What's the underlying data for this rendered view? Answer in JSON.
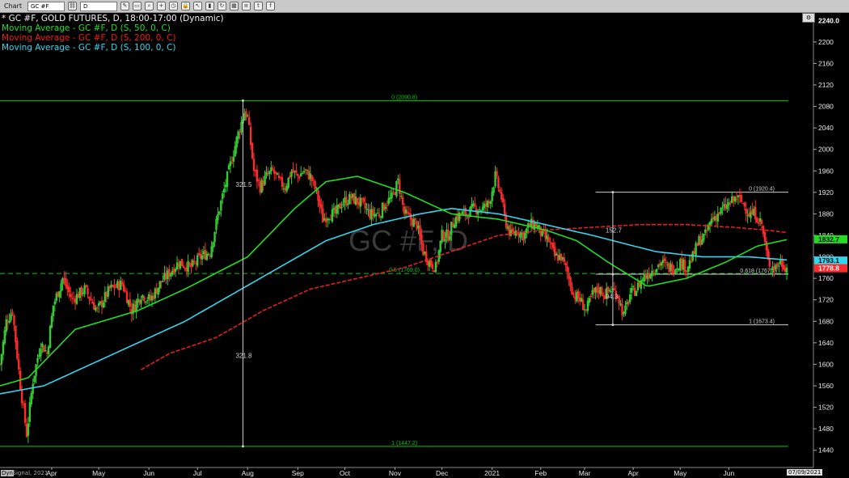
{
  "toolbar": {
    "chart_label": "Chart",
    "symbol_value": "GC #F",
    "interval_value": "D"
  },
  "legend": {
    "main": "* GC #F, GOLD FUTURES, D, 18:00-17:00 (Dynamic)",
    "ma50": "Moving Average - GC #F, D (S, 50, 0, C)",
    "ma200": "Moving Average - GC #F, D (S, 200, 0, C)",
    "ma100": "Moving Average - GC #F, D (S, 100, 0, C)"
  },
  "colors": {
    "background": "#000000",
    "up_candle": "#33cc33",
    "down_candle": "#ff2b2b",
    "ma50": "#22dd22",
    "ma100": "#33d6ee",
    "ma200": "#ee1b1b",
    "fib": "#00cc00",
    "measure": "#cfcfcf"
  },
  "bottom": {
    "copyright": "© eSignal, 2021",
    "dyn_label": "Dyn",
    "last_date": "07/09/2021"
  },
  "chart_data": {
    "type": "candlestick",
    "watermark": "GC #F, D",
    "ylim": [
      1420,
      2250
    ],
    "yticks": [
      1440,
      1480,
      1520,
      1560,
      1600,
      1640,
      1680,
      1720,
      1760,
      1800,
      1840,
      1880,
      1920,
      1960,
      2000,
      2040,
      2080,
      2120,
      2160,
      2200,
      2240
    ],
    "xticks": [
      {
        "label": "Apr",
        "day": 15
      },
      {
        "label": "May",
        "day": 45
      },
      {
        "label": "Jun",
        "day": 77
      },
      {
        "label": "Jul",
        "day": 108
      },
      {
        "label": "Aug",
        "day": 140
      },
      {
        "label": "Sep",
        "day": 172
      },
      {
        "label": "Oct",
        "day": 202
      },
      {
        "label": "Nov",
        "day": 234
      },
      {
        "label": "Dec",
        "day": 264
      },
      {
        "label": "2021",
        "day": 296
      },
      {
        "label": "Feb",
        "day": 327
      },
      {
        "label": "Mar",
        "day": 355
      },
      {
        "label": "Apr",
        "day": 386
      },
      {
        "label": "May",
        "day": 416
      },
      {
        "label": "Jun",
        "day": 447
      }
    ],
    "day_range": [
      -18,
      485
    ],
    "price_anchors": [
      [
        -18,
        1600
      ],
      [
        -14,
        1680
      ],
      [
        -10,
        1700
      ],
      [
        -5,
        1560
      ],
      [
        -1,
        1470
      ],
      [
        3,
        1570
      ],
      [
        8,
        1640
      ],
      [
        12,
        1620
      ],
      [
        16,
        1710
      ],
      [
        22,
        1760
      ],
      [
        28,
        1720
      ],
      [
        36,
        1740
      ],
      [
        44,
        1700
      ],
      [
        52,
        1740
      ],
      [
        60,
        1750
      ],
      [
        66,
        1700
      ],
      [
        72,
        1730
      ],
      [
        78,
        1720
      ],
      [
        84,
        1750
      ],
      [
        90,
        1770
      ],
      [
        96,
        1790
      ],
      [
        104,
        1780
      ],
      [
        110,
        1800
      ],
      [
        116,
        1810
      ],
      [
        122,
        1890
      ],
      [
        128,
        1960
      ],
      [
        134,
        2030
      ],
      [
        138,
        2070
      ],
      [
        140,
        2060
      ],
      [
        144,
        1960
      ],
      [
        148,
        1930
      ],
      [
        152,
        1950
      ],
      [
        156,
        1960
      ],
      [
        160,
        1940
      ],
      [
        164,
        1930
      ],
      [
        168,
        1960
      ],
      [
        172,
        1950
      ],
      [
        176,
        1960
      ],
      [
        180,
        1950
      ],
      [
        184,
        1920
      ],
      [
        188,
        1870
      ],
      [
        192,
        1880
      ],
      [
        196,
        1880
      ],
      [
        200,
        1900
      ],
      [
        206,
        1910
      ],
      [
        212,
        1900
      ],
      [
        218,
        1880
      ],
      [
        224,
        1880
      ],
      [
        228,
        1900
      ],
      [
        232,
        1910
      ],
      [
        236,
        1940
      ],
      [
        240,
        1880
      ],
      [
        244,
        1870
      ],
      [
        248,
        1860
      ],
      [
        252,
        1810
      ],
      [
        256,
        1790
      ],
      [
        260,
        1780
      ],
      [
        264,
        1840
      ],
      [
        268,
        1840
      ],
      [
        272,
        1870
      ],
      [
        276,
        1880
      ],
      [
        280,
        1880
      ],
      [
        284,
        1890
      ],
      [
        290,
        1890
      ],
      [
        294,
        1900
      ],
      [
        298,
        1950
      ],
      [
        302,
        1910
      ],
      [
        304,
        1870
      ],
      [
        308,
        1840
      ],
      [
        312,
        1850
      ],
      [
        316,
        1840
      ],
      [
        320,
        1860
      ],
      [
        324,
        1860
      ],
      [
        328,
        1840
      ],
      [
        332,
        1830
      ],
      [
        336,
        1800
      ],
      [
        340,
        1800
      ],
      [
        344,
        1770
      ],
      [
        348,
        1730
      ],
      [
        352,
        1720
      ],
      [
        356,
        1700
      ],
      [
        360,
        1730
      ],
      [
        364,
        1740
      ],
      [
        368,
        1730
      ],
      [
        372,
        1740
      ],
      [
        376,
        1730
      ],
      [
        380,
        1690
      ],
      [
        384,
        1730
      ],
      [
        388,
        1740
      ],
      [
        392,
        1760
      ],
      [
        396,
        1770
      ],
      [
        400,
        1780
      ],
      [
        404,
        1790
      ],
      [
        408,
        1780
      ],
      [
        412,
        1780
      ],
      [
        416,
        1790
      ],
      [
        420,
        1780
      ],
      [
        424,
        1800
      ],
      [
        428,
        1830
      ],
      [
        432,
        1840
      ],
      [
        436,
        1870
      ],
      [
        440,
        1880
      ],
      [
        444,
        1890
      ],
      [
        448,
        1900
      ],
      [
        452,
        1910
      ],
      [
        456,
        1900
      ],
      [
        460,
        1880
      ],
      [
        464,
        1880
      ],
      [
        468,
        1860
      ],
      [
        472,
        1790
      ],
      [
        476,
        1780
      ],
      [
        480,
        1790
      ],
      [
        484,
        1780
      ]
    ],
    "ma50": [
      [
        -18,
        1560
      ],
      [
        0,
        1575
      ],
      [
        30,
        1665
      ],
      [
        70,
        1700
      ],
      [
        100,
        1740
      ],
      [
        120,
        1770
      ],
      [
        140,
        1800
      ],
      [
        170,
        1890
      ],
      [
        190,
        1940
      ],
      [
        210,
        1950
      ],
      [
        240,
        1920
      ],
      [
        270,
        1880
      ],
      [
        300,
        1870
      ],
      [
        330,
        1850
      ],
      [
        350,
        1830
      ],
      [
        370,
        1790
      ],
      [
        395,
        1745
      ],
      [
        420,
        1760
      ],
      [
        445,
        1790
      ],
      [
        465,
        1820
      ],
      [
        485,
        1832.7
      ]
    ],
    "ma100": [
      [
        -18,
        1545
      ],
      [
        10,
        1560
      ],
      [
        40,
        1600
      ],
      [
        70,
        1640
      ],
      [
        100,
        1680
      ],
      [
        130,
        1730
      ],
      [
        160,
        1780
      ],
      [
        190,
        1830
      ],
      [
        220,
        1860
      ],
      [
        250,
        1880
      ],
      [
        270,
        1890
      ],
      [
        300,
        1880
      ],
      [
        330,
        1860
      ],
      [
        360,
        1840
      ],
      [
        380,
        1825
      ],
      [
        400,
        1810
      ],
      [
        430,
        1800
      ],
      [
        460,
        1800
      ],
      [
        485,
        1794
      ]
    ],
    "ma200": [
      [
        72,
        1590
      ],
      [
        90,
        1620
      ],
      [
        120,
        1650
      ],
      [
        150,
        1700
      ],
      [
        180,
        1740
      ],
      [
        210,
        1760
      ],
      [
        240,
        1780
      ],
      [
        270,
        1810
      ],
      [
        300,
        1840
      ],
      [
        330,
        1850
      ],
      [
        360,
        1855
      ],
      [
        390,
        1860
      ],
      [
        420,
        1860
      ],
      [
        450,
        1855
      ],
      [
        470,
        1850
      ],
      [
        485,
        1845
      ]
    ],
    "price_labels": [
      {
        "value": 2240.0,
        "label": "2240.0",
        "bg": "#000000",
        "fg": "#ffffff"
      },
      {
        "value": 1832.7,
        "label": "1832.7",
        "bg": "#22dd22",
        "fg": "#000000"
      },
      {
        "value": 1793.1,
        "label": "1793.1",
        "bg": "#33d6ee",
        "fg": "#000000"
      },
      {
        "value": 1778.8,
        "label": "1778.8",
        "bg": "#ff2b2b",
        "fg": "#ffffff"
      }
    ],
    "fib_levels": [
      {
        "value": 2090.8,
        "label": "0 (2090.8)",
        "x_from": -18,
        "x_to": 485,
        "color": "#00cc00",
        "dashed": false,
        "label_day": 240
      },
      {
        "value": 1769.0,
        "label": "0.5 (1769.0)",
        "x_from": -18,
        "x_to": 485,
        "color": "#00cc00",
        "dashed": true,
        "label_day": 240
      },
      {
        "value": 1447.2,
        "label": "1 (1447.2)",
        "x_from": -18,
        "x_to": 485,
        "color": "#00cc00",
        "dashed": false,
        "label_day": 240
      },
      {
        "value": 1920.4,
        "label": "0 (1920.4)",
        "x_from": 362,
        "x_to": 485,
        "color": "#cfcfcf",
        "dashed": false,
        "label_day": 468
      },
      {
        "value": 1767.7,
        "label": "0.618 (1767.7)",
        "x_from": 362,
        "x_to": 485,
        "color": "#cfcfcf",
        "dashed": false,
        "label_day": 466
      },
      {
        "value": 1673.4,
        "label": "1 (1673.4)",
        "x_from": 362,
        "x_to": 485,
        "color": "#cfcfcf",
        "dashed": false,
        "label_day": 468
      }
    ],
    "measures": [
      {
        "day": 137,
        "from": 2090.8,
        "to": 1447.2,
        "label_top": "321.5",
        "label_mid": "321.8",
        "label_top_at": 1930,
        "label_mid_at": 1612
      },
      {
        "day": 373,
        "from": 1920.4,
        "to": 1767.7,
        "label_top": "152.7",
        "label_top_at": 1845
      },
      {
        "day": 373,
        "from": 1767.7,
        "to": 1673.4,
        "label_top": "94.3",
        "label_top_at": 1722
      }
    ]
  }
}
